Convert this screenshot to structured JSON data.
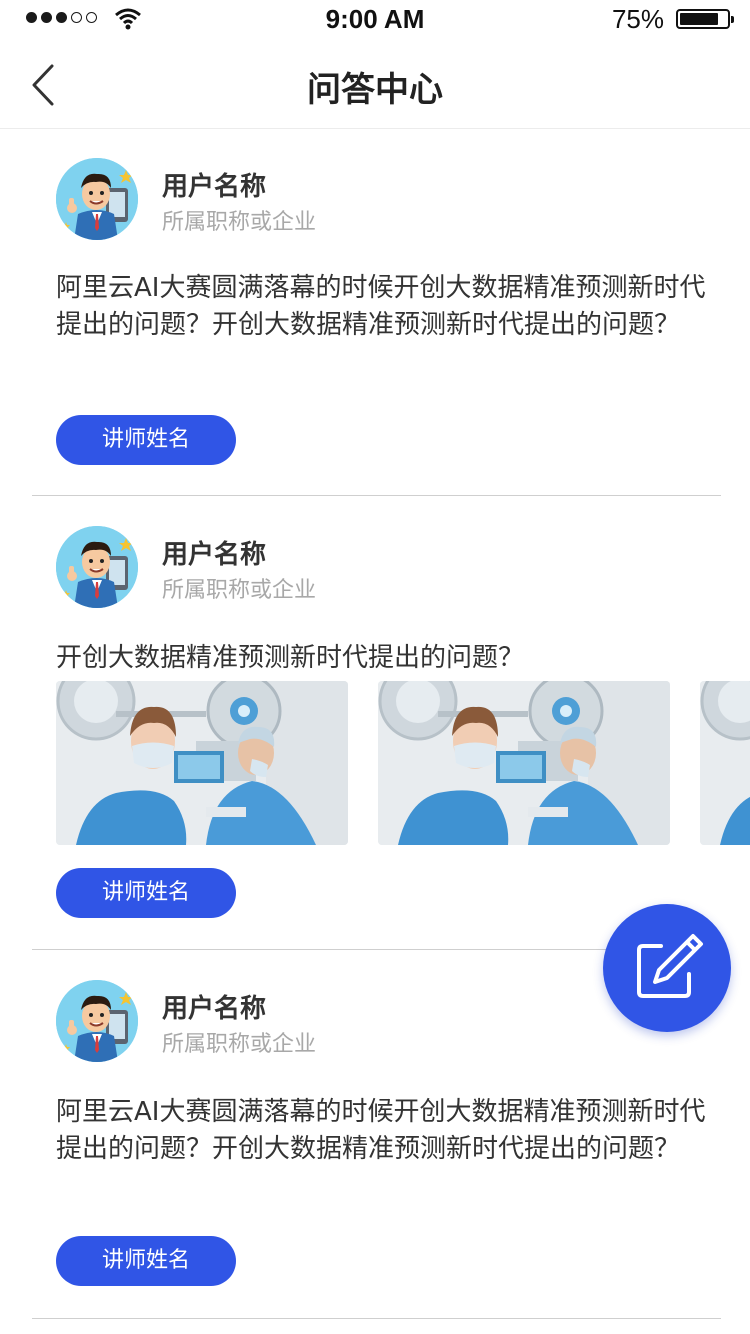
{
  "status": {
    "time": "9:00 AM",
    "battery": "75%"
  },
  "nav": {
    "title": "问答中心",
    "back_icon": "chevron-left-icon"
  },
  "posts": [
    {
      "user_name": "用户名称",
      "user_title": "所属职称或企业",
      "question": "阿里云AI大赛圆满落幕的时候开创大数据精准预测新时代提出的问题？开创大数据精准预测新时代提出的问题？",
      "teacher_label": "讲师姓名"
    },
    {
      "user_name": "用户名称",
      "user_title": "所属职称或企业",
      "question": "开创大数据精准预测新时代提出的问题？",
      "teacher_label": "讲师姓名",
      "image_count": 3
    },
    {
      "user_name": "用户名称",
      "user_title": "所属职称或企业",
      "question": "阿里云AI大赛圆满落幕的时候开创大数据精准预测新时代提出的问题？开创大数据精准预测新时代提出的问题？",
      "teacher_label": "讲师姓名"
    }
  ],
  "fab": {
    "icon": "edit-icon"
  },
  "colors": {
    "accent": "#3055e6",
    "divider": "#cfcfcf",
    "subtext": "#a8a8a8"
  }
}
